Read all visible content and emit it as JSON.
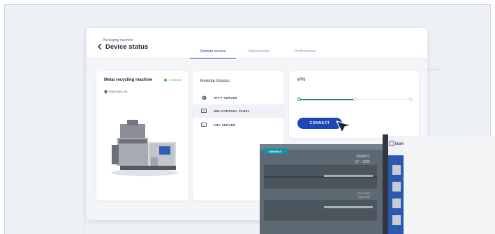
{
  "header": {
    "breadcrumb": "Packaging machine",
    "title": "Device status"
  },
  "tabs": [
    {
      "label": "Remote access",
      "active": true
    },
    {
      "label": "Maintenance",
      "active": false
    },
    {
      "label": "Performance",
      "active": false
    }
  ],
  "machine": {
    "name": "Metal recycling machine",
    "status": "Connected",
    "status_color": "#41b861",
    "location": "Eindhoven, NL"
  },
  "remote_access": {
    "title": "Remote Access",
    "items": [
      {
        "label": "HTTP SERVER",
        "icon": "globe-icon",
        "selected": false
      },
      {
        "label": "HMI CONTROL PANEL",
        "icon": "monitor-icon",
        "selected": true
      },
      {
        "label": "VNC SERVER",
        "icon": "monitor-icon",
        "selected": false
      }
    ]
  },
  "vpn": {
    "title": "VPN",
    "progress": 0.5,
    "connect_label": "CONNECT",
    "accent": "#1e45b8",
    "progress_color": "#1f8a52"
  },
  "plc": {
    "brand": "SIEMENS",
    "model_line1": "SIMATIC",
    "model_line2": "S7 - 1200",
    "cpu_line1": "CPU 1214C",
    "cpu_line2": "DC/DC/DC",
    "gateway_brand": "ixon"
  }
}
